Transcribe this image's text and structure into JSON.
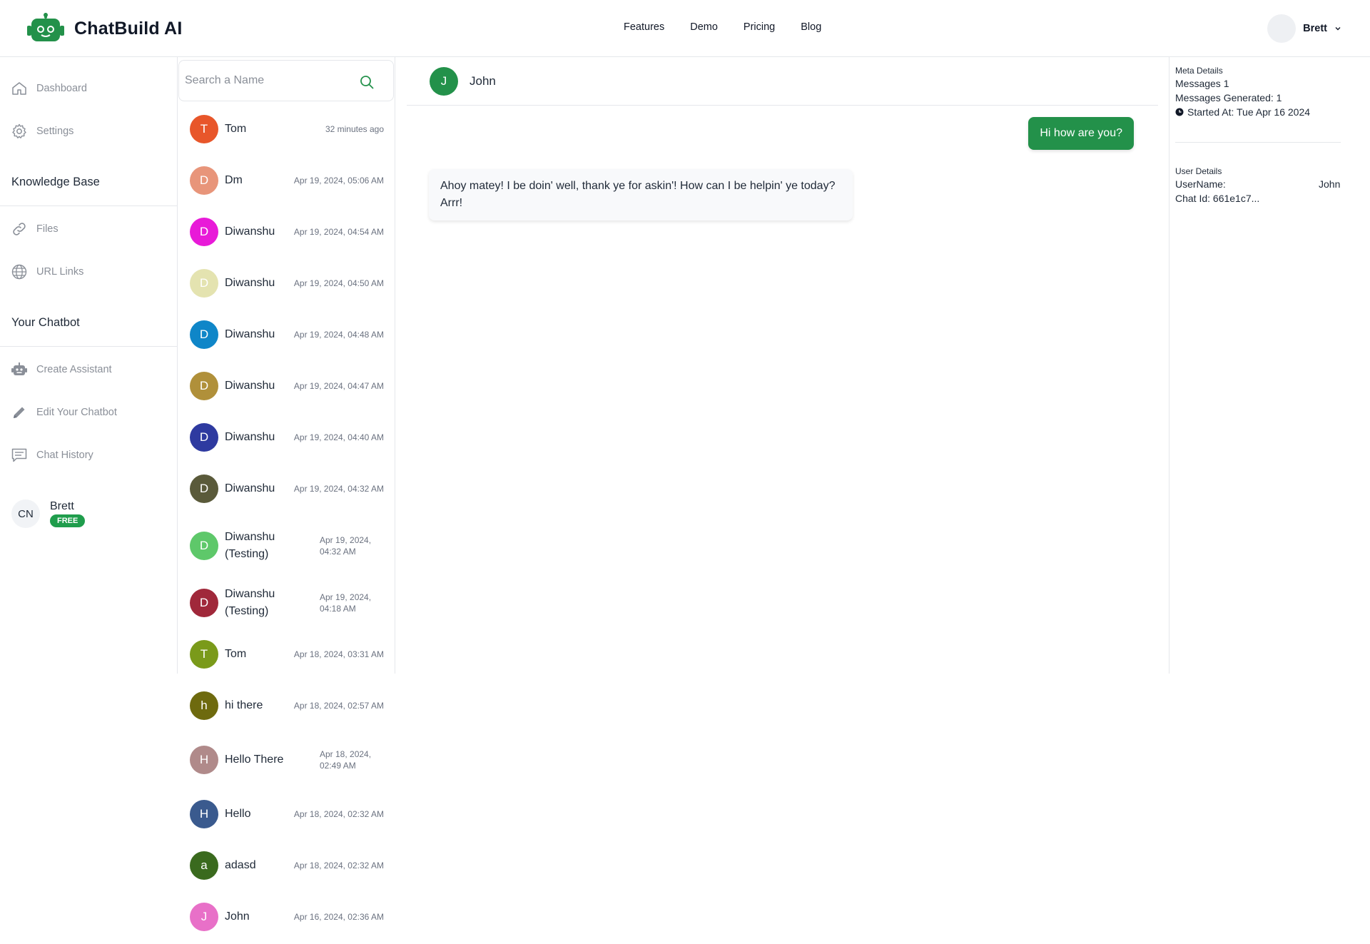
{
  "app": {
    "brand_name": "ChatBuild AI",
    "accent_color": "#23914a"
  },
  "topnav": {
    "links": [
      "Features",
      "Demo",
      "Pricing",
      "Blog"
    ]
  },
  "user_menu": {
    "name": "Brett"
  },
  "sidebar": {
    "items_main": [
      {
        "label": "Dashboard",
        "icon": "home-icon"
      },
      {
        "label": "Settings",
        "icon": "gear-icon"
      }
    ],
    "section_knowledge": "Knowledge Base",
    "items_knowledge": [
      {
        "label": "Files",
        "icon": "link-icon"
      },
      {
        "label": "URL Links",
        "icon": "globe-icon"
      }
    ],
    "section_chatbot": "Your Chatbot",
    "items_chatbot": [
      {
        "label": "Create Assistant",
        "icon": "robot-icon"
      },
      {
        "label": "Edit Your Chatbot",
        "icon": "pencil-icon"
      },
      {
        "label": "Chat History",
        "icon": "chat-history-icon"
      }
    ],
    "profile": {
      "initials": "CN",
      "name": "Brett",
      "plan": "FREE"
    }
  },
  "search": {
    "placeholder": "Search a Name",
    "value": ""
  },
  "conversations": [
    {
      "initial": "T",
      "name": "Tom",
      "time": "32 minutes ago",
      "color": "#e8562a"
    },
    {
      "initial": "D",
      "name": "Dm",
      "time": "Apr 19, 2024, 05:06 AM",
      "color": "#e8957a"
    },
    {
      "initial": "D",
      "name": "Diwanshu",
      "time": "Apr 19, 2024, 04:54 AM",
      "color": "#e81ad8"
    },
    {
      "initial": "D",
      "name": "Diwanshu",
      "time": "Apr 19, 2024, 04:50 AM",
      "color": "#e4e3b0"
    },
    {
      "initial": "D",
      "name": "Diwanshu",
      "time": "Apr 19, 2024, 04:48 AM",
      "color": "#0f86c8"
    },
    {
      "initial": "D",
      "name": "Diwanshu",
      "time": "Apr 19, 2024, 04:47 AM",
      "color": "#b0903a"
    },
    {
      "initial": "D",
      "name": "Diwanshu",
      "time": "Apr 19, 2024, 04:40 AM",
      "color": "#2e3aa0"
    },
    {
      "initial": "D",
      "name": "Diwanshu",
      "time": "Apr 19, 2024, 04:32 AM",
      "color": "#5a5a3a"
    },
    {
      "initial": "D",
      "name": "Diwanshu (Testing)",
      "time": "Apr 19, 2024, 04:32 AM",
      "color": "#5ec86a"
    },
    {
      "initial": "D",
      "name": "Diwanshu (Testing)",
      "time": "Apr 19, 2024, 04:18 AM",
      "color": "#a0283a"
    },
    {
      "initial": "T",
      "name": "Tom",
      "time": "Apr 18, 2024, 03:31 AM",
      "color": "#7a9a1a"
    },
    {
      "initial": "h",
      "name": "hi there",
      "time": "Apr 18, 2024, 02:57 AM",
      "color": "#6e6a0e"
    },
    {
      "initial": "H",
      "name": "Hello There",
      "time": "Apr 18, 2024, 02:49 AM",
      "color": "#b08a8a"
    },
    {
      "initial": "H",
      "name": "Hello",
      "time": "Apr 18, 2024, 02:32 AM",
      "color": "#3a5a8e"
    },
    {
      "initial": "a",
      "name": "adasd",
      "time": "Apr 18, 2024, 02:32 AM",
      "color": "#3a6a1e"
    },
    {
      "initial": "J",
      "name": "John",
      "time": "Apr 16, 2024, 02:36 AM",
      "color": "#e870c8"
    }
  ],
  "chat": {
    "contact_initial": "J",
    "contact_name": "John",
    "messages": [
      {
        "from": "user",
        "text": "Hi how are you?"
      },
      {
        "from": "bot",
        "text": "Ahoy matey! I be doin' well, thank ye for askin'! How can I be helpin' ye today? Arrr!"
      }
    ]
  },
  "meta": {
    "meta_heading": "Meta Details",
    "messages": "Messages 1",
    "messages_generated": "Messages Generated: 1",
    "started_at": "Started At: Tue Apr 16 2024",
    "user_heading": "User Details",
    "username_label": "UserName:",
    "username_value": "John",
    "chat_id": "Chat Id: 661e1c7..."
  }
}
